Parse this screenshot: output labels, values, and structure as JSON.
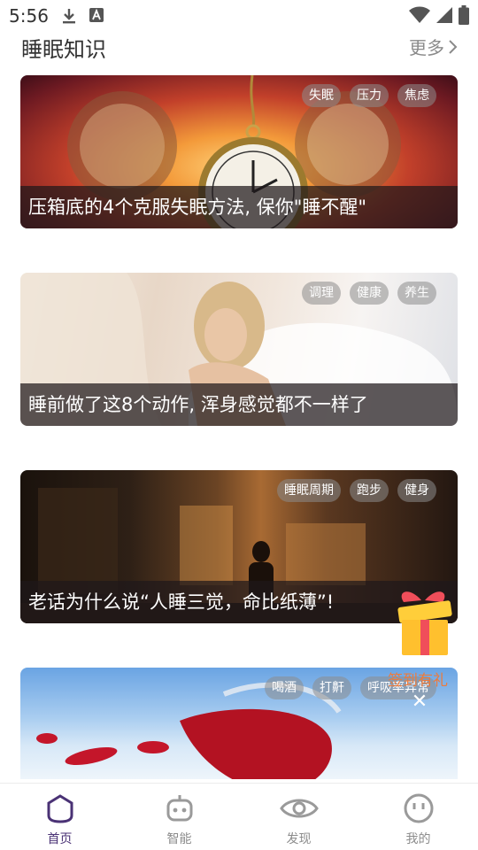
{
  "status_bar": {
    "time": "5:56",
    "left_icons": [
      "download-icon",
      "text-a-icon"
    ],
    "right_icons": [
      "wifi-icon",
      "signal-icon",
      "battery-icon"
    ]
  },
  "section": {
    "title": "睡眠知识",
    "more_label": "更多"
  },
  "articles": [
    {
      "tags": [
        "失眠",
        "压力",
        "焦虑"
      ],
      "title": "压箱底的4个克服失眠方法, 保你\"睡不醒\""
    },
    {
      "tags": [
        "调理",
        "健康",
        "养生"
      ],
      "title": "睡前做了这8个动作, 浑身感觉都不一样了"
    },
    {
      "tags": [
        "睡眠周期",
        "跑步",
        "健身"
      ],
      "title": "老话为什么说“人睡三觉，命比纸薄”!"
    },
    {
      "tags": [
        "喝酒",
        "打鼾",
        "呼吸率异常"
      ],
      "title": ""
    }
  ],
  "promo": {
    "label": "签到有礼",
    "close": "✕"
  },
  "tabs": [
    {
      "label": "首页",
      "icon": "home-icon",
      "active": true
    },
    {
      "label": "智能",
      "icon": "robot-icon",
      "active": false
    },
    {
      "label": "发现",
      "icon": "eye-icon",
      "active": false
    },
    {
      "label": "我的",
      "icon": "face-icon",
      "active": false
    }
  ],
  "colors": {
    "accent": "#4a3275",
    "inactive": "#8c8c8c",
    "promo": "#ec7b3c"
  }
}
